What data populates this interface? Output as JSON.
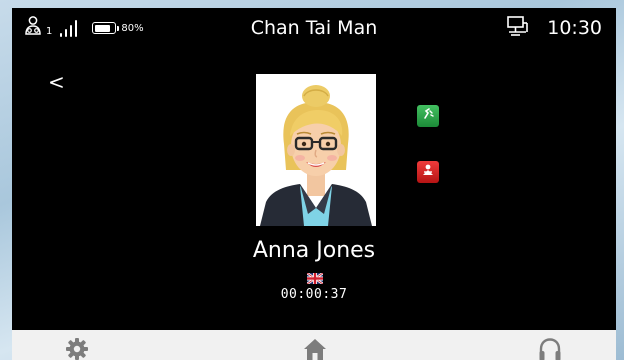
{
  "status_bar": {
    "contacts_count": "1",
    "battery_text": "80%",
    "battery_level": 0.8,
    "title": "Chan Tai Man",
    "time": "10:30"
  },
  "call": {
    "back_label": "<",
    "contact_name": "Anna Jones",
    "duration": "00:00:37",
    "language_flag_icon": "uk-flag-icon",
    "answer_icon": "phone-answer-icon",
    "hangup_icon": "phone-hangup-icon"
  },
  "bottom_nav": {
    "items": [
      {
        "icon": "gear-icon"
      },
      {
        "icon": "home-icon"
      },
      {
        "icon": "headset-icon"
      }
    ]
  },
  "colors": {
    "screen_background": "#000000",
    "nav_background": "#f1f1f1",
    "answer_green": "#2aa847",
    "hangup_red": "#d42525",
    "icon_gray": "#7d7d7d"
  }
}
